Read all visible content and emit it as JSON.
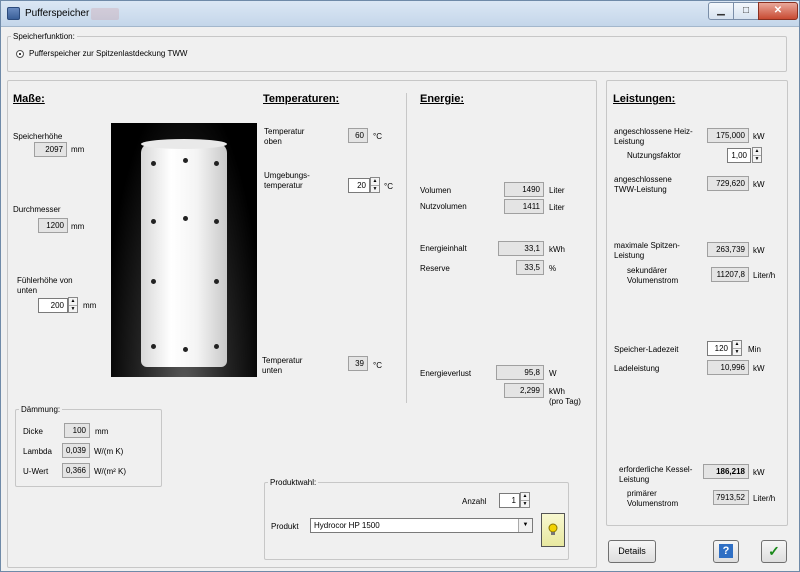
{
  "window": {
    "title": "Pufferspeicher"
  },
  "speicherfunktion": {
    "legend": "Speicherfunktion:",
    "option": "Pufferspeicher zur Spitzenlastdeckung TWW"
  },
  "masse": {
    "title": "Maße:",
    "hoehe_label": "Speicherhöhe",
    "hoehe": "2097",
    "hoehe_unit": "mm",
    "durchmesser_label": "Durchmesser",
    "durchmesser": "1200",
    "durchmesser_unit": "mm",
    "fuehler_label": "Fühlerhöhe von unten",
    "fuehler": "200",
    "fuehler_unit": "mm"
  },
  "daemmung": {
    "legend": "Dämmung:",
    "dicke_label": "Dicke",
    "dicke": "100",
    "dicke_unit": "mm",
    "lambda_label": "Lambda",
    "lambda": "0,039",
    "lambda_unit": "W/(m K)",
    "uwert_label": "U-Wert",
    "uwert": "0,366",
    "uwert_unit": "W/(m² K)"
  },
  "temperaturen": {
    "title": "Temperaturen:",
    "oben_label": "Temperatur oben",
    "oben": "60",
    "oben_unit": "°C",
    "umgebung_label": "Umgebungs-temperatur",
    "umgebung": "20",
    "umgebung_unit": "°C",
    "unten_label": "Temperatur unten",
    "unten": "39",
    "unten_unit": "°C"
  },
  "energie": {
    "title": "Energie:",
    "volumen_label": "Volumen",
    "volumen": "1490",
    "volumen_unit": "Liter",
    "nutzvolumen_label": "Nutzvolumen",
    "nutzvolumen": "1411",
    "nutzvolumen_unit": "Liter",
    "inhalt_label": "Energieinhalt",
    "inhalt": "33,1",
    "inhalt_unit": "kWh",
    "reserve_label": "Reserve",
    "reserve": "33,5",
    "reserve_unit": "%",
    "verlust_label": "Energieverlust",
    "verlust_w": "95,8",
    "verlust_w_unit": "W",
    "verlust_kwh": "2,299",
    "verlust_kwh_unit": "kWh",
    "verlust_kwh_unit2": "(pro Tag)"
  },
  "produktwahl": {
    "legend": "Produktwahl:",
    "anzahl_label": "Anzahl",
    "anzahl": "1",
    "produkt_label": "Produkt",
    "produkt": "Hydrocor HP 1500"
  },
  "leistungen": {
    "title": "Leistungen:",
    "heiz_label": "angeschlossene Heiz-Leistung",
    "heiz": "175,000",
    "heiz_unit": "kW",
    "nutzung_label": "Nutzungsfaktor",
    "nutzung": "1,00",
    "tww_label": "angeschlossene TWW-Leistung",
    "tww": "729,620",
    "tww_unit": "kW",
    "spitze_label": "maximale Spitzen-Leistung",
    "spitze": "263,739",
    "spitze_unit": "kW",
    "sek_label": "sekundärer Volumenstrom",
    "sek": "11207,8",
    "sek_unit": "Liter/h",
    "ladezeit_label": "Speicher-Ladezeit",
    "ladezeit": "120",
    "ladezeit_unit": "Min",
    "ladeleistung_label": "Ladeleistung",
    "ladeleistung": "10,996",
    "ladeleistung_unit": "kW",
    "kessel_label": "erforderliche Kessel-Leistung",
    "kessel": "186,218",
    "kessel_unit": "kW",
    "prim_label": "primärer Volumenstrom",
    "prim": "7913,52",
    "prim_unit": "Liter/h"
  },
  "buttons": {
    "details": "Details",
    "help": "?",
    "ok": "✓"
  }
}
